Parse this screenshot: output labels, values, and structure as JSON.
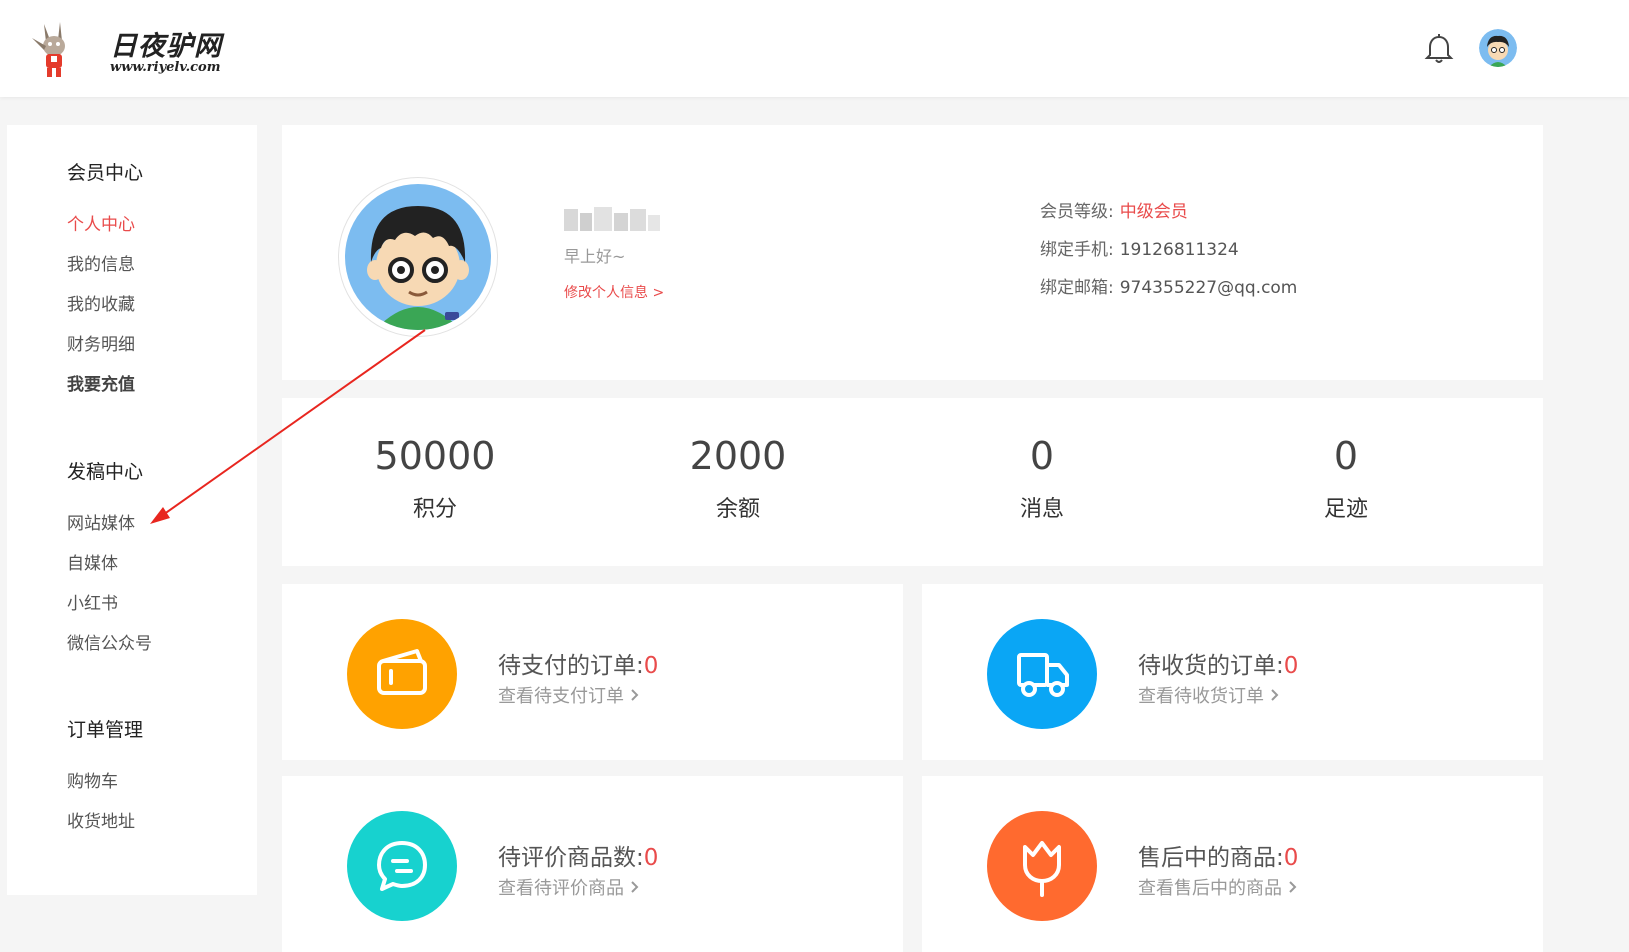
{
  "header": {
    "logo_title": "日夜驴网",
    "logo_url": "www.riyelv.com"
  },
  "sidebar": {
    "groups": [
      {
        "title": "会员中心",
        "items": [
          "个人中心",
          "我的信息",
          "我的收藏",
          "财务明细",
          "我要充值"
        ]
      },
      {
        "title": "发稿中心",
        "items": [
          "网站媒体",
          "自媒体",
          "小红书",
          "微信公众号"
        ]
      },
      {
        "title": "订单管理",
        "items": [
          "购物车",
          "收货地址"
        ]
      }
    ],
    "active_item": "个人中心"
  },
  "profile": {
    "greeting": "早上好~",
    "edit_link": "修改个人信息 >",
    "level_label": "会员等级:",
    "level_value": "中级会员",
    "phone_label": "绑定手机:",
    "phone_value": "19126811324",
    "email_label": "绑定邮箱:",
    "email_value": "974355227@qq.com"
  },
  "stats": [
    {
      "value": "50000",
      "label": "积分"
    },
    {
      "value": "2000",
      "label": "余额"
    },
    {
      "value": "0",
      "label": "消息"
    },
    {
      "value": "0",
      "label": "足迹"
    }
  ],
  "orders": [
    {
      "title": "待支付的订单:",
      "count": "0",
      "link": "查看待支付订单",
      "color": "#ffa200",
      "icon": "wallet-icon"
    },
    {
      "title": "待收货的订单:",
      "count": "0",
      "link": "查看待收货订单",
      "color": "#0aa6f5",
      "icon": "truck-icon"
    },
    {
      "title": "待评价商品数:",
      "count": "0",
      "link": "查看待评价商品",
      "color": "#17d2cf",
      "icon": "comment-icon"
    },
    {
      "title": "售后中的商品:",
      "count": "0",
      "link": "查看售后中的商品",
      "color": "#ff6a2f",
      "icon": "flower-icon"
    }
  ],
  "colors": {
    "accent": "#e94b4b"
  }
}
